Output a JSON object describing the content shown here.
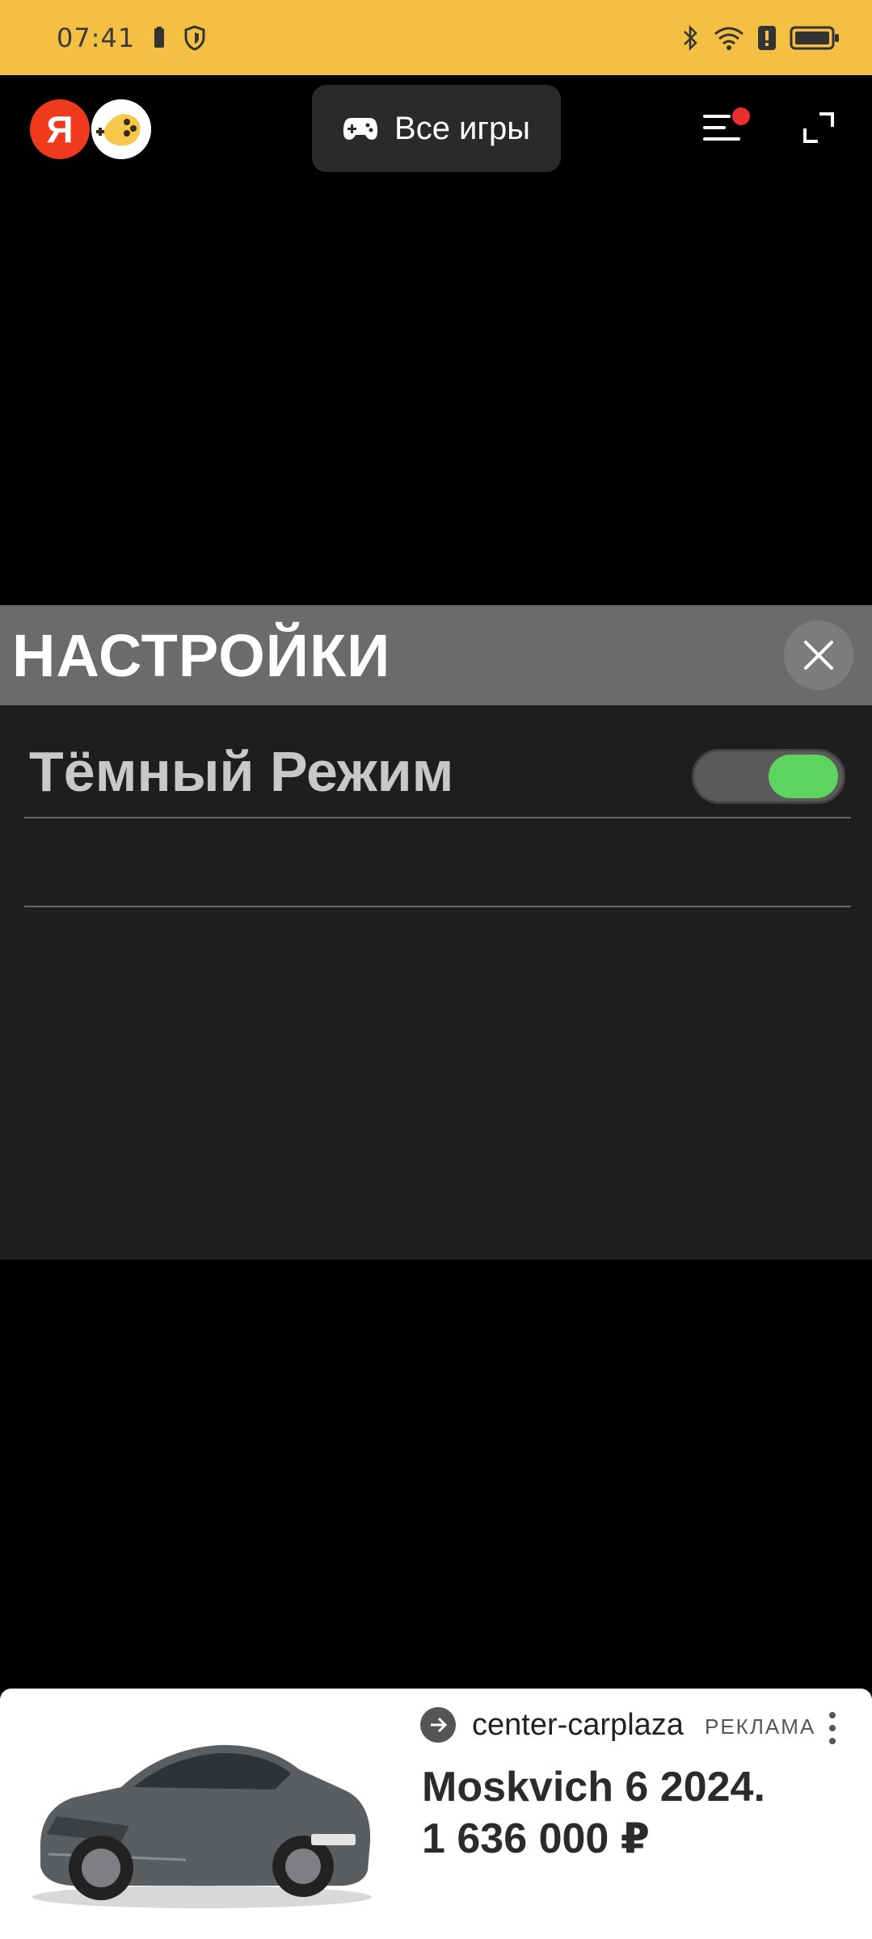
{
  "status_bar": {
    "time": "07:41",
    "icons": [
      "battery-saver-icon",
      "shield-icon",
      "bluetooth-icon",
      "wifi-icon",
      "alert-icon",
      "battery-icon"
    ]
  },
  "app_bar": {
    "logo_letter": "Я",
    "all_games_label": "Все игры",
    "icons": [
      "gamepad-icon",
      "menu-icon",
      "expand-icon"
    ]
  },
  "settings": {
    "title": "НАСТРОЙКИ",
    "dark_mode_label": "Тёмный Режим",
    "dark_mode_enabled": true
  },
  "ad": {
    "domain": "center-carplaza",
    "label": "РЕКЛАМА",
    "title_line1": "Moskvich 6 2024.",
    "title_line2": "1 636 000 ₽"
  },
  "colors": {
    "status_bar_bg": "#f4c043",
    "toggle_on": "#5fd35f",
    "yandex_red": "#f03a1e"
  }
}
